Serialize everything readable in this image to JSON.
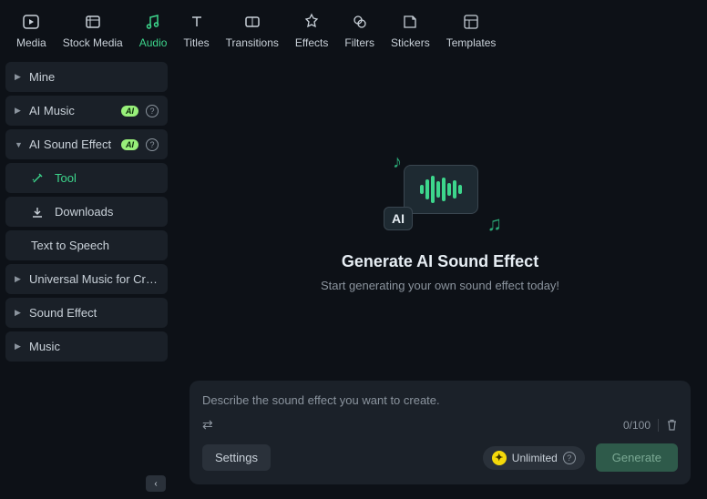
{
  "toolbar": {
    "tabs": [
      {
        "label": "Media",
        "icon": "media"
      },
      {
        "label": "Stock Media",
        "icon": "stock"
      },
      {
        "label": "Audio",
        "icon": "audio",
        "active": true
      },
      {
        "label": "Titles",
        "icon": "titles"
      },
      {
        "label": "Transitions",
        "icon": "transitions"
      },
      {
        "label": "Effects",
        "icon": "effects"
      },
      {
        "label": "Filters",
        "icon": "filters"
      },
      {
        "label": "Stickers",
        "icon": "stickers"
      },
      {
        "label": "Templates",
        "icon": "templates"
      }
    ]
  },
  "sidebar": {
    "items": [
      {
        "label": "Mine",
        "caret": "▶"
      },
      {
        "label": "AI Music",
        "caret": "▶",
        "badge": "AI",
        "help": true
      },
      {
        "label": "AI Sound Effect",
        "caret": "▼",
        "badge": "AI",
        "help": true,
        "expanded": true
      },
      {
        "label": "Universal Music for Cre...",
        "caret": "▶"
      },
      {
        "label": "Sound Effect",
        "caret": "▶"
      },
      {
        "label": "Music",
        "caret": "▶"
      }
    ],
    "sub_items": {
      "tool": "Tool",
      "downloads": "Downloads",
      "text_to_speech": "Text to Speech"
    }
  },
  "hero": {
    "ai_label": "AI",
    "title": "Generate AI Sound Effect",
    "subtitle": "Start generating your own sound effect today!"
  },
  "prompt": {
    "placeholder": "Describe the sound effect you want to create.",
    "counter": "0/100"
  },
  "actions": {
    "settings": "Settings",
    "unlimited": "Unlimited",
    "generate": "Generate"
  }
}
